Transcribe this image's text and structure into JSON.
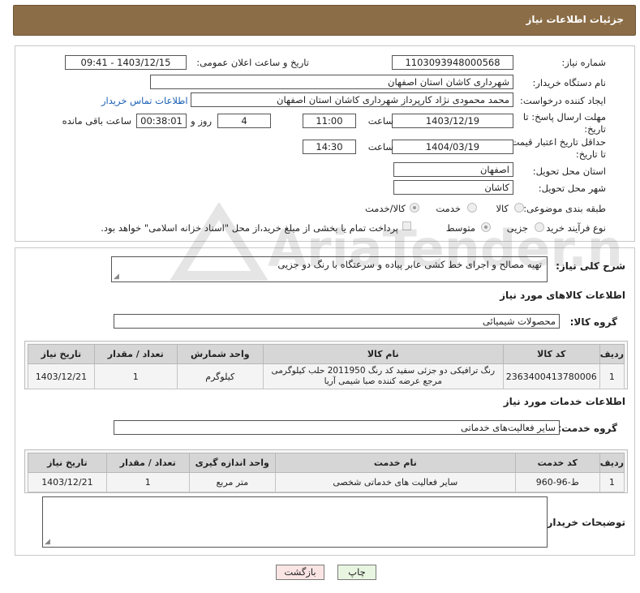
{
  "header": {
    "title": "جزئیات اطلاعات نیاز"
  },
  "need_number": {
    "label": "شماره نیاز:",
    "value": "1103093948000568"
  },
  "announce": {
    "label": "تاریخ و ساعت اعلان عمومی:",
    "value": "1403/12/15 - 09:41"
  },
  "buyer_org": {
    "label": "نام دستگاه خریدار:",
    "value": "شهرداری کاشان استان اصفهان"
  },
  "requester": {
    "label": "ایجاد کننده درخواست:",
    "value": "محمد محمودی نژاد کارپرداز شهرداری کاشان استان اصفهان",
    "contact_link": "اطلاعات تماس خریدار"
  },
  "deadline": {
    "label": "مهلت ارسال پاسخ: تا تاریخ:",
    "date": "1403/12/19",
    "time_label": "ساعت",
    "time": "11:00",
    "days": "4",
    "days_label": "روز و",
    "remaining": "00:38:01",
    "remaining_label": "ساعت باقی مانده"
  },
  "validity": {
    "label": "حداقل تاریخ اعتبار قیمت: تا تاریخ:",
    "date": "1404/03/19",
    "time_label": "ساعت",
    "time": "14:30"
  },
  "province": {
    "label": "استان محل تحویل:",
    "value": "اصفهان"
  },
  "city": {
    "label": "شهر محل تحویل:",
    "value": "کاشان"
  },
  "category": {
    "label": "طبقه بندی موضوعی:",
    "options": [
      "کالا",
      "خدمت",
      "کالا/خدمت"
    ]
  },
  "process": {
    "label": "نوع فرآیند خرید :",
    "options": [
      "جزیی",
      "متوسط"
    ],
    "note": "پرداخت تمام یا بخشی از مبلغ خرید،از محل \"اسناد خزانه اسلامی\" خواهد بود."
  },
  "summary": {
    "label": "شرح کلی نیاز:",
    "value": "تهیه مصالح و اجرای خط کشی عابر پیاده و سرعتگاه با رنگ دو جزیی"
  },
  "goods_section": {
    "title": "اطلاعات کالاهای مورد نیاز",
    "group_label": "گروه کالا:",
    "group_value": "محصولات شیمیائی"
  },
  "goods_table": {
    "headers": [
      "ردیف",
      "کد کالا",
      "نام کالا",
      "واحد شمارش",
      "تعداد / مقدار",
      "تاریخ نیاز"
    ],
    "rows": [
      {
        "idx": "1",
        "code": "2363400413780006",
        "name": "رنگ ترافیکی دو جزئی سفید کد رنگ 2011950 حلب کیلوگرمی مرجع عرضه کننده صبا شیمی آریا",
        "unit": "کیلوگرم",
        "qty": "1",
        "date": "1403/12/21"
      }
    ]
  },
  "services_section": {
    "title": "اطلاعات خدمات مورد نیاز",
    "group_label": "گروه خدمت:",
    "group_value": "سایر فعالیت‌های خدماتی"
  },
  "services_table": {
    "headers": [
      "ردیف",
      "کد خدمت",
      "نام خدمت",
      "واحد اندازه گیری",
      "تعداد / مقدار",
      "تاریخ نیاز"
    ],
    "rows": [
      {
        "idx": "1",
        "code": "ط-96-960",
        "name": "سایر فعالیت های خدماتی شخصی",
        "unit": "متر مربع",
        "qty": "1",
        "date": "1403/12/21"
      }
    ]
  },
  "buyer_notes": {
    "label": "توضیحات خریدار:",
    "value": ""
  },
  "buttons": {
    "print": "چاپ",
    "back": "بازگشت"
  },
  "watermark": {
    "text": "AriaTender.net"
  }
}
